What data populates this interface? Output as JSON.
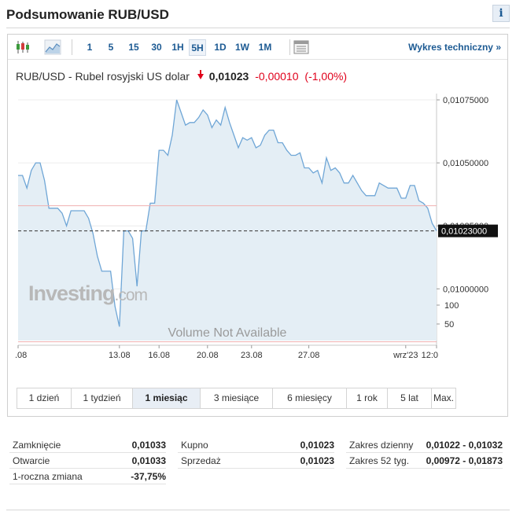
{
  "header": {
    "title": "Podsumowanie RUB/USD",
    "info_label": "i"
  },
  "toolbar": {
    "icons": [
      "candlestick-icon",
      "area-chart-icon",
      "settings-panel-icon"
    ],
    "ranges": [
      "1",
      "5",
      "15",
      "30",
      "1H",
      "5H",
      "1D",
      "1W",
      "1M"
    ],
    "active_range": "5H",
    "tech_link": "Wykres techniczny »"
  },
  "quote": {
    "name": "RUB/USD - Rubel rosyjski US dolar",
    "last": "0,01023",
    "change": "-0,00010",
    "change_pct": "(-1,00%)",
    "direction": "down"
  },
  "chart_data": {
    "type": "area",
    "instrument": "RUB/USD",
    "series": [
      {
        "name": "RUB/USD",
        "x": [
          0,
          1,
          2,
          3,
          4,
          5,
          6,
          7,
          8,
          9,
          10,
          11,
          12,
          13,
          14,
          15,
          16,
          17,
          18,
          19,
          20,
          21,
          22,
          23,
          24,
          25,
          26,
          27,
          28,
          29,
          30,
          31,
          32,
          33,
          34,
          35,
          36,
          37,
          38,
          39,
          40,
          41,
          42,
          43,
          44,
          45,
          46,
          47,
          48,
          49,
          50,
          51,
          52,
          53,
          54,
          55,
          56,
          57,
          58,
          59,
          60,
          61,
          62,
          63,
          64,
          65,
          66,
          67,
          68,
          69,
          70,
          71,
          72,
          73,
          74,
          75,
          76,
          77,
          78,
          79,
          80,
          81,
          82,
          83,
          84,
          85,
          86,
          87,
          88,
          89,
          90,
          91,
          92,
          93,
          94,
          95
        ],
        "values": [
          0.01045,
          0.01045,
          0.0104,
          0.01047,
          0.0105,
          0.0105,
          0.01043,
          0.01032,
          0.01032,
          0.01032,
          0.0103,
          0.01025,
          0.01031,
          0.01031,
          0.01031,
          0.01031,
          0.01028,
          0.01022,
          0.01013,
          0.01007,
          0.01007,
          0.01007,
          0.00993,
          0.00985,
          0.01023,
          0.01023,
          0.0102,
          0.01001,
          0.01023,
          0.01023,
          0.01034,
          0.01034,
          0.01055,
          0.01055,
          0.01053,
          0.01061,
          0.01075,
          0.0107,
          0.01065,
          0.01066,
          0.01066,
          0.01068,
          0.01071,
          0.01069,
          0.01064,
          0.01067,
          0.01065,
          0.01072,
          0.01066,
          0.01061,
          0.01056,
          0.0106,
          0.01059,
          0.0106,
          0.01056,
          0.01057,
          0.01061,
          0.01063,
          0.01063,
          0.01058,
          0.01058,
          0.01055,
          0.01053,
          0.01053,
          0.01054,
          0.01048,
          0.01048,
          0.01046,
          0.01047,
          0.01042,
          0.01052,
          0.01047,
          0.01048,
          0.01046,
          0.01042,
          0.01042,
          0.01045,
          0.01042,
          0.01039,
          0.01037,
          0.01037,
          0.01037,
          0.01042,
          0.01041,
          0.0104,
          0.0104,
          0.0104,
          0.01036,
          0.01036,
          0.01041,
          0.01041,
          0.01035,
          0.01034,
          0.01032,
          0.01026,
          0.01023
        ]
      }
    ],
    "x_tick_labels": [
      {
        "x": -0.3,
        "label": ".08"
      },
      {
        "x": 23,
        "label": "13.08"
      },
      {
        "x": 32,
        "label": "16.08"
      },
      {
        "x": 43,
        "label": "20.08"
      },
      {
        "x": 53,
        "label": "23.08"
      },
      {
        "x": 66,
        "label": "27.08"
      },
      {
        "x": 88,
        "label": "wrz'23"
      },
      {
        "x": 95,
        "label": "12:0"
      }
    ],
    "y_ticks": [
      "0,01075000",
      "0,01050000",
      "0,01025000",
      "0,01000000"
    ],
    "y_tick_values": [
      0.01075,
      0.0105,
      0.01025,
      0.01
    ],
    "ylim": [
      0.009795,
      0.010775
    ],
    "reference_lines": [
      {
        "value": 0.01033,
        "color": "#f0b0b0",
        "style": "solid"
      },
      {
        "value": 0.00979,
        "color": "#f0b0b0",
        "style": "solid"
      }
    ],
    "current_value": 0.01023,
    "current_label": "0,01023000",
    "volume": {
      "message": "Volume Not Available",
      "y_ticks": [
        "100",
        "50"
      ]
    },
    "watermark": "Investing.com",
    "colors": {
      "line": "#6fa6d6",
      "fill": "#e4eef5",
      "grid": "#ececec",
      "current_tag": "#111111"
    }
  },
  "tabs": [
    "1 dzień",
    "1 tydzień",
    "1 miesiąc",
    "3 miesiące",
    "6 miesięcy",
    "1 rok",
    "5 lat",
    "Max."
  ],
  "active_tab": "1 miesiąc",
  "stats": {
    "col1": [
      {
        "label": "Zamknięcie",
        "value": "0,01033"
      },
      {
        "label": "Otwarcie",
        "value": "0,01033"
      },
      {
        "label": "1-roczna zmiana",
        "value": "-37,75%"
      }
    ],
    "col2": [
      {
        "label": "Kupno",
        "value": "0,01023"
      },
      {
        "label": "Sprzedaż",
        "value": "0,01023"
      }
    ],
    "col3": [
      {
        "label": "Zakres dzienny",
        "value": "0,01022 - 0,01032"
      },
      {
        "label": "Zakres 52 tyg.",
        "value": "0,00972 - 0,01873"
      }
    ]
  }
}
